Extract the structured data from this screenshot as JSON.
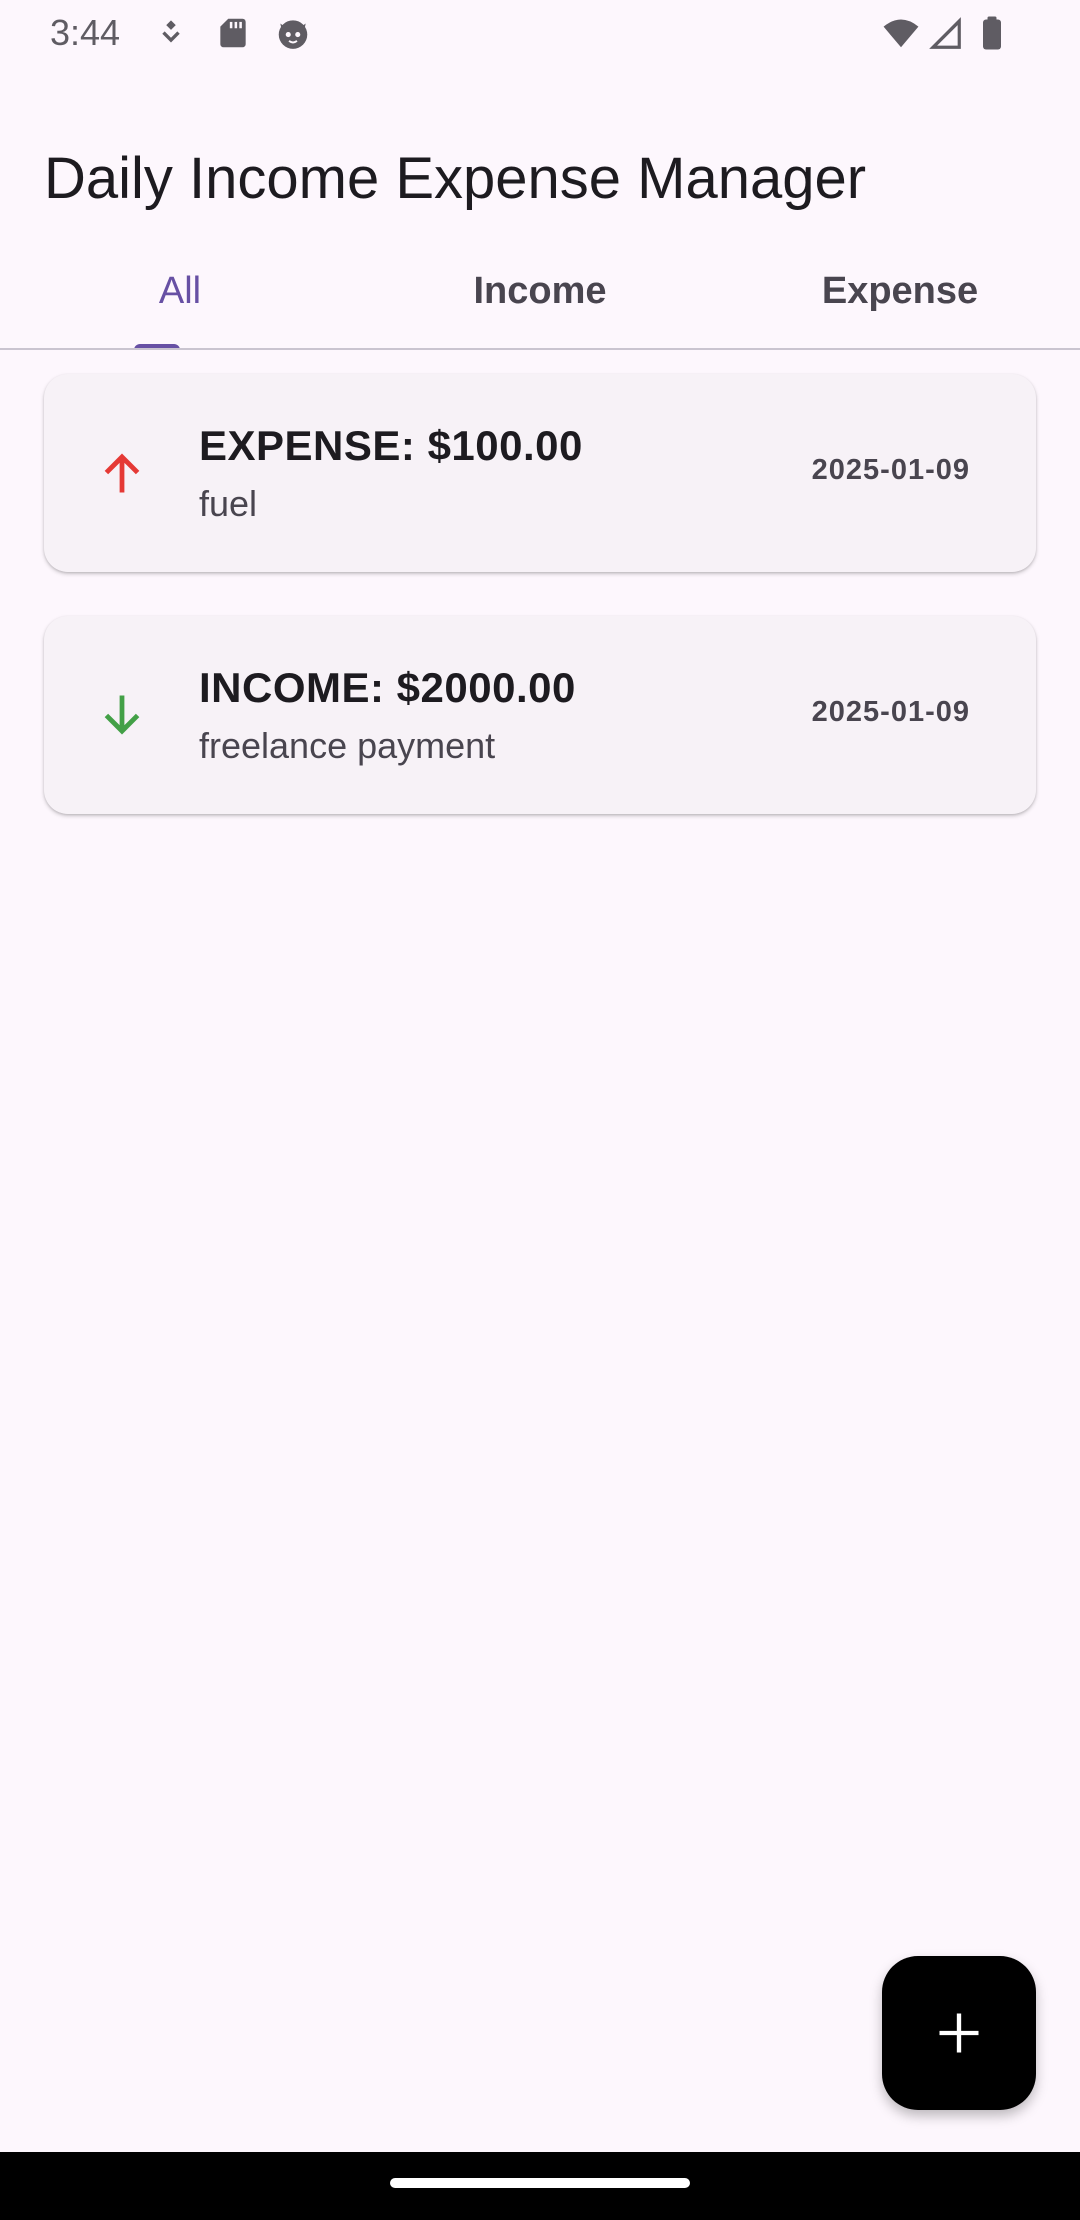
{
  "status_bar": {
    "time": "3:44",
    "left_icons": [
      "nfc-icon",
      "sd-card-icon",
      "cat-face-icon"
    ],
    "right_icons": [
      "wifi-icon",
      "cellular-signal-icon",
      "battery-icon"
    ]
  },
  "app": {
    "title": "Daily Income Expense Manager"
  },
  "tabs": [
    {
      "label": "All",
      "active": true
    },
    {
      "label": "Income",
      "active": false
    },
    {
      "label": "Expense",
      "active": false
    }
  ],
  "transactions": [
    {
      "type": "expense",
      "title": "EXPENSE: $100.00",
      "description": "fuel",
      "date": "2025-01-09",
      "icon": "arrow-up-icon",
      "icon_color": "#E53935"
    },
    {
      "type": "income",
      "title": "INCOME: $2000.00",
      "description": "freelance payment",
      "date": "2025-01-09",
      "icon": "arrow-down-icon",
      "icon_color": "#43A047"
    }
  ],
  "fab": {
    "icon": "plus-icon",
    "background": "#000000"
  },
  "colors": {
    "background": "#FDF7FD",
    "accent": "#6750A4",
    "card": "#F7F2F7"
  }
}
